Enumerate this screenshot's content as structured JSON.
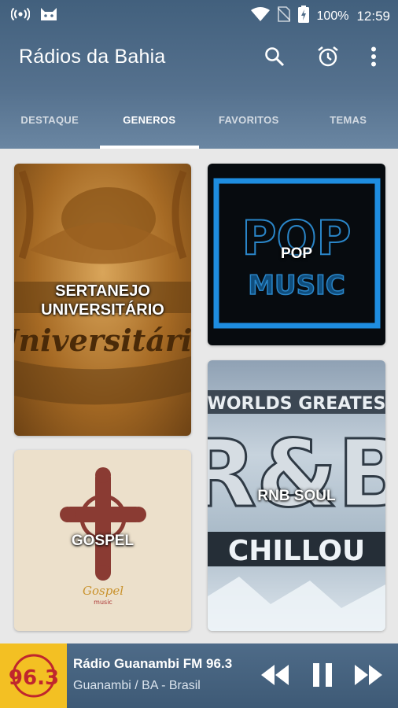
{
  "status_bar": {
    "battery": "100%",
    "time": "12:59"
  },
  "toolbar": {
    "title": "Rádios da Bahia"
  },
  "tabs": [
    {
      "label": "DESTAQUE",
      "active": false
    },
    {
      "label": "GENEROS",
      "active": true
    },
    {
      "label": "FAVORITOS",
      "active": false
    },
    {
      "label": "TEMAS",
      "active": false
    }
  ],
  "genres": [
    {
      "label": "SERTANEJO UNIVERSITÁRIO",
      "artwork_text": "Universitário"
    },
    {
      "label": "POP",
      "artwork_text_top": "POP",
      "artwork_text_bottom": "MUSIC"
    },
    {
      "label": "RNB SOUL",
      "artwork_text_top": "WORLDS GREATES",
      "artwork_text_mid": "R&B",
      "artwork_text_bottom": "CHILLOU"
    },
    {
      "label": "GOSPEL",
      "artwork_text_top": "Gospel",
      "artwork_text_bottom": "music"
    }
  ],
  "player": {
    "station": "Rádio Guanambi FM 96.3",
    "location": "Guanambi / BA - Brasil",
    "logo_text": "96.3"
  },
  "colors": {
    "appbar": "#4f6c89",
    "player": "#456280",
    "cover": "#f3c023"
  }
}
